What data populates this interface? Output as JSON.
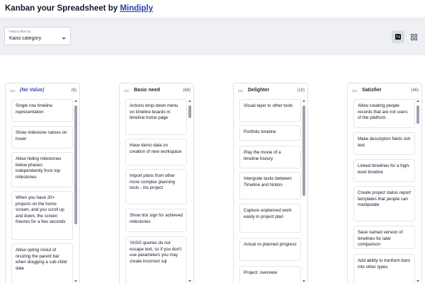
{
  "header": {
    "title_prefix": "Kanban your Spreadsheet by",
    "brand_link": "Mindiply"
  },
  "filter": {
    "legend": "Field to filter by",
    "value": "Kano category"
  },
  "view_toggles": [
    {
      "icon": "kanban-view-icon",
      "active": true
    },
    {
      "icon": "grid-view-icon",
      "active": false
    }
  ],
  "columns": [
    {
      "title": "(No Value)",
      "count": "(6)",
      "cards": [
        "Single row timeline representation",
        "Show milestone names on hover",
        "Allow hiding milestones below phases independently from top milestones",
        "When you have 20+ projects on the home screen, and you scroll up and down, the screen freezes for a few seconds",
        "Allow opting in/out of resizing the parent bar when dragging a sub-child date"
      ]
    },
    {
      "title": "Basic need",
      "count": "(68)",
      "cards": [
        "Actions drop-down menu on timeline boards in timeline home page",
        "Have demo data on creation of new workspace",
        "Import plans from other more complex planning tools - ms project",
        "Show tick sign for achieved milestones",
        "YASO queries do not escape text, so if you don't use parameters you may create incorrect sql"
      ]
    },
    {
      "title": "Delighter",
      "count": "(10)",
      "cards": [
        "Visual layer to other tools",
        "Portfolio timeline",
        "Play the movie of a timeline history",
        "Intergrate tasks between Timeline and Notion",
        "Capture unplanned work easily in project plan",
        "Actual vs planned progress",
        "Project: overview"
      ]
    },
    {
      "title": "Satisfier",
      "count": "(46)",
      "cards": [
        "Allow creating people records that are not users of the platform",
        "Make description fields rich text",
        "Linked timelines for a high-level timeline",
        "Create project status report templates that people can manipulate",
        "Save named version of timelines for later comparison",
        "Add ability to tranform bars into other types"
      ]
    }
  ]
}
